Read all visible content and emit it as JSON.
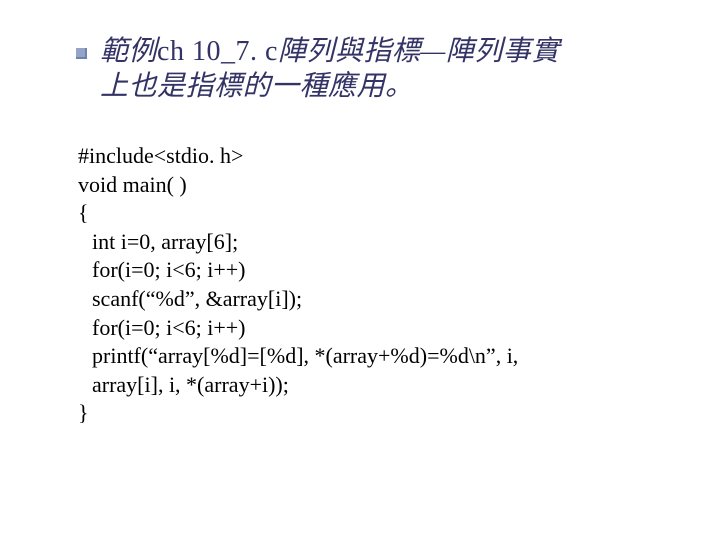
{
  "title": {
    "line1_pre": "範例",
    "line1_ascii": "ch 10_7. c",
    "line1_post": "陣列與指標—陣列事實",
    "line2": "上也是指標的一種應用。"
  },
  "code": {
    "l1": "#include<stdio. h>",
    "l2": "void main( )",
    "l3": "{",
    "l4": "int i=0, array[6];",
    "l5": "for(i=0; i<6; i++)",
    "l6": "scanf(“%d”, &array[i]);",
    "l7": "for(i=0; i<6; i++)",
    "l8": "printf(“array[%d]=[%d], *(array+%d)=%d\\n”, i,",
    "l9": "array[i], i, *(array+i));",
    "l10": "}"
  }
}
